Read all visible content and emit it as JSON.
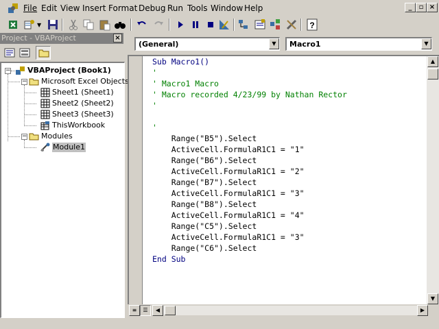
{
  "menubar": {
    "items": [
      {
        "label": "File"
      },
      {
        "label": "Edit"
      },
      {
        "label": "View"
      },
      {
        "label": "Insert"
      },
      {
        "label": "Format"
      },
      {
        "label": "Debug"
      },
      {
        "label": "Run"
      },
      {
        "label": "Tools"
      },
      {
        "label": "Window"
      },
      {
        "label": "Help"
      }
    ]
  },
  "project_pane": {
    "title": "Project - VBAProject",
    "tree": {
      "root": "VBAProject (Book1)",
      "folder_objects": "Microsoft Excel Objects",
      "sheet1": "Sheet1 (Sheet1)",
      "sheet2": "Sheet2 (Sheet2)",
      "sheet3": "Sheet3 (Sheet3)",
      "workbook": "ThisWorkbook",
      "folder_modules": "Modules",
      "module1": "Module1"
    }
  },
  "code_window": {
    "object_combo": "(General)",
    "procedure_combo": "Macro1",
    "lines": [
      {
        "text": "Sub Macro1()",
        "style": "kw"
      },
      {
        "text": "'",
        "style": "cm"
      },
      {
        "text": "' Macro1 Macro",
        "style": "cm"
      },
      {
        "text": "' Macro recorded 4/23/99 by Nathan Rector",
        "style": "cm"
      },
      {
        "text": "'",
        "style": "cm"
      },
      {
        "text": "",
        "style": ""
      },
      {
        "text": "'",
        "style": "cm"
      },
      {
        "text": "    Range(\"B5\").Select",
        "style": ""
      },
      {
        "text": "    ActiveCell.FormulaR1C1 = \"1\"",
        "style": ""
      },
      {
        "text": "    Range(\"B6\").Select",
        "style": ""
      },
      {
        "text": "    ActiveCell.FormulaR1C1 = \"2\"",
        "style": ""
      },
      {
        "text": "    Range(\"B7\").Select",
        "style": ""
      },
      {
        "text": "    ActiveCell.FormulaR1C1 = \"3\"",
        "style": ""
      },
      {
        "text": "    Range(\"B8\").Select",
        "style": ""
      },
      {
        "text": "    ActiveCell.FormulaR1C1 = \"4\"",
        "style": ""
      },
      {
        "text": "    Range(\"C5\").Select",
        "style": ""
      },
      {
        "text": "    ActiveCell.FormulaR1C1 = \"3\"",
        "style": ""
      },
      {
        "text": "    Range(\"C6\").Select",
        "style": ""
      },
      {
        "text": "End Sub",
        "style": "kw"
      }
    ]
  },
  "colors": {
    "keyword": "#000080",
    "comment": "#008000",
    "pane_title_bg": "#808080",
    "chrome": "#d4d0c8",
    "selection_bg": "#c0c0c0"
  },
  "icons": {
    "app": "vba-icon",
    "view_excel": "excel-icon",
    "insert_module": "insert-module-icon",
    "save": "save-icon",
    "cut": "cut-icon",
    "copy": "copy-icon",
    "paste": "paste-icon",
    "find": "find-icon",
    "undo": "undo-icon",
    "redo": "redo-icon",
    "run": "run-icon",
    "break": "break-icon",
    "reset": "reset-icon",
    "design_mode": "design-mode-icon",
    "project_explorer": "project-explorer-icon",
    "properties": "properties-icon",
    "object_browser": "object-browser-icon",
    "toolbox": "toolbox-icon",
    "help": "help-icon"
  }
}
